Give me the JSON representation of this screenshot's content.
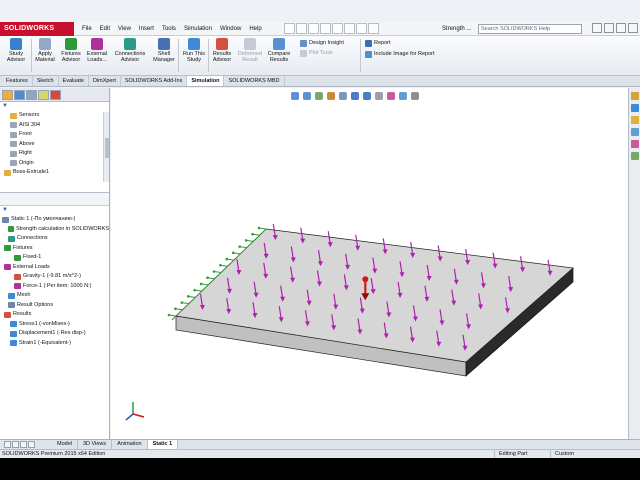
{
  "app": {
    "brand": "SOLIDWORKS",
    "menu": [
      "File",
      "Edit",
      "View",
      "Insert",
      "Tools",
      "Simulation",
      "Window",
      "Help"
    ],
    "document_name": "Strength ...",
    "search_placeholder": "Search SOLIDWORKS Help"
  },
  "ribbon": {
    "buttons": [
      {
        "label": "Study Advisor",
        "color": "#3b7fd1"
      },
      {
        "label": "Apply Material",
        "color": "#8fa9c9"
      },
      {
        "label": "Fixtures Advisor",
        "color": "#2e9b3a"
      },
      {
        "label": "External Loads...",
        "color": "#b0319b"
      },
      {
        "label": "Connections Advisor",
        "color": "#2b9a8b"
      },
      {
        "label": "Shell Manager",
        "color": "#4b6fb4"
      },
      {
        "label": "Run This Study",
        "color": "#3d8ad6"
      },
      {
        "label": "Results Advisor",
        "color": "#d5503e"
      },
      {
        "label": "Deformed Result",
        "color": "#c6ccd6"
      },
      {
        "label": "Compare Results",
        "color": "#5a8fd0"
      }
    ],
    "small_left": [
      "Design Insight",
      "Plot Tools"
    ],
    "small_right": [
      "Report",
      "Include Image for Report"
    ]
  },
  "command_tabs": [
    "Features",
    "Sketch",
    "Evaluate",
    "DimXpert",
    "SOLIDWORKS Add-Ins",
    "Simulation",
    "SOLIDWORKS MBD"
  ],
  "active_command_tab": "Simulation",
  "feature_tree": [
    {
      "label": "Sensors",
      "color": "#e0b03a"
    },
    {
      "label": "AISI 304",
      "color": "#9aa6b4"
    },
    {
      "label": "Front",
      "color": "#9aa6b4"
    },
    {
      "label": "Above",
      "color": "#9aa6b4"
    },
    {
      "label": "Right",
      "color": "#9aa6b4"
    },
    {
      "label": "Origin",
      "color": "#9aa6b4"
    },
    {
      "label": "Boss-Extrude1",
      "color": "#e0b03a"
    }
  ],
  "study_tree": [
    {
      "label": "Static 1 (-По умолчанию-)",
      "color": "#6f86a8"
    },
    {
      "label": "Strength calculation in SOLIDWORKS",
      "color": "#2e9b3a"
    },
    {
      "label": "Connections",
      "color": "#2b9a8b"
    },
    {
      "label": "Fixtures",
      "color": "#2e9b3a"
    },
    {
      "label": "Fixed-1",
      "color": "#2e9b3a"
    },
    {
      "label": "External Loads",
      "color": "#b0319b"
    },
    {
      "label": "Gravity-1 (-9.81 m/s^2-)",
      "color": "#d5503e"
    },
    {
      "label": "Force-1 (:Per item: 1000 N:)",
      "color": "#b0319b"
    },
    {
      "label": "Mesh",
      "color": "#3d8ad6"
    },
    {
      "label": "Result Options",
      "color": "#6f86a8"
    },
    {
      "label": "Results",
      "color": "#d5503e"
    },
    {
      "label": "Stress1 (-vonMises-)",
      "color": "#3d8ad6"
    },
    {
      "label": "Displacement1 (-Res disp-)",
      "color": "#3d8ad6"
    },
    {
      "label": "Strain1 (-Equivalent-)",
      "color": "#3d8ad6"
    }
  ],
  "bottom_tabs": [
    "Model",
    "3D Views",
    "Animation",
    "Static 1"
  ],
  "active_bottom_tab": "Static 1",
  "status": {
    "edition": "SOLIDWORKS Premium 2015 x64 Edition",
    "mode": "Editing Part",
    "units": "Custom"
  },
  "model": {
    "plate_top": "#d6d6d6",
    "plate_front": "#c0c0c0",
    "plate_side": "#2a2a2a",
    "force_color": "#b020b0",
    "fixture_color": "#2ea02e",
    "gravity_color": "#d01818"
  }
}
